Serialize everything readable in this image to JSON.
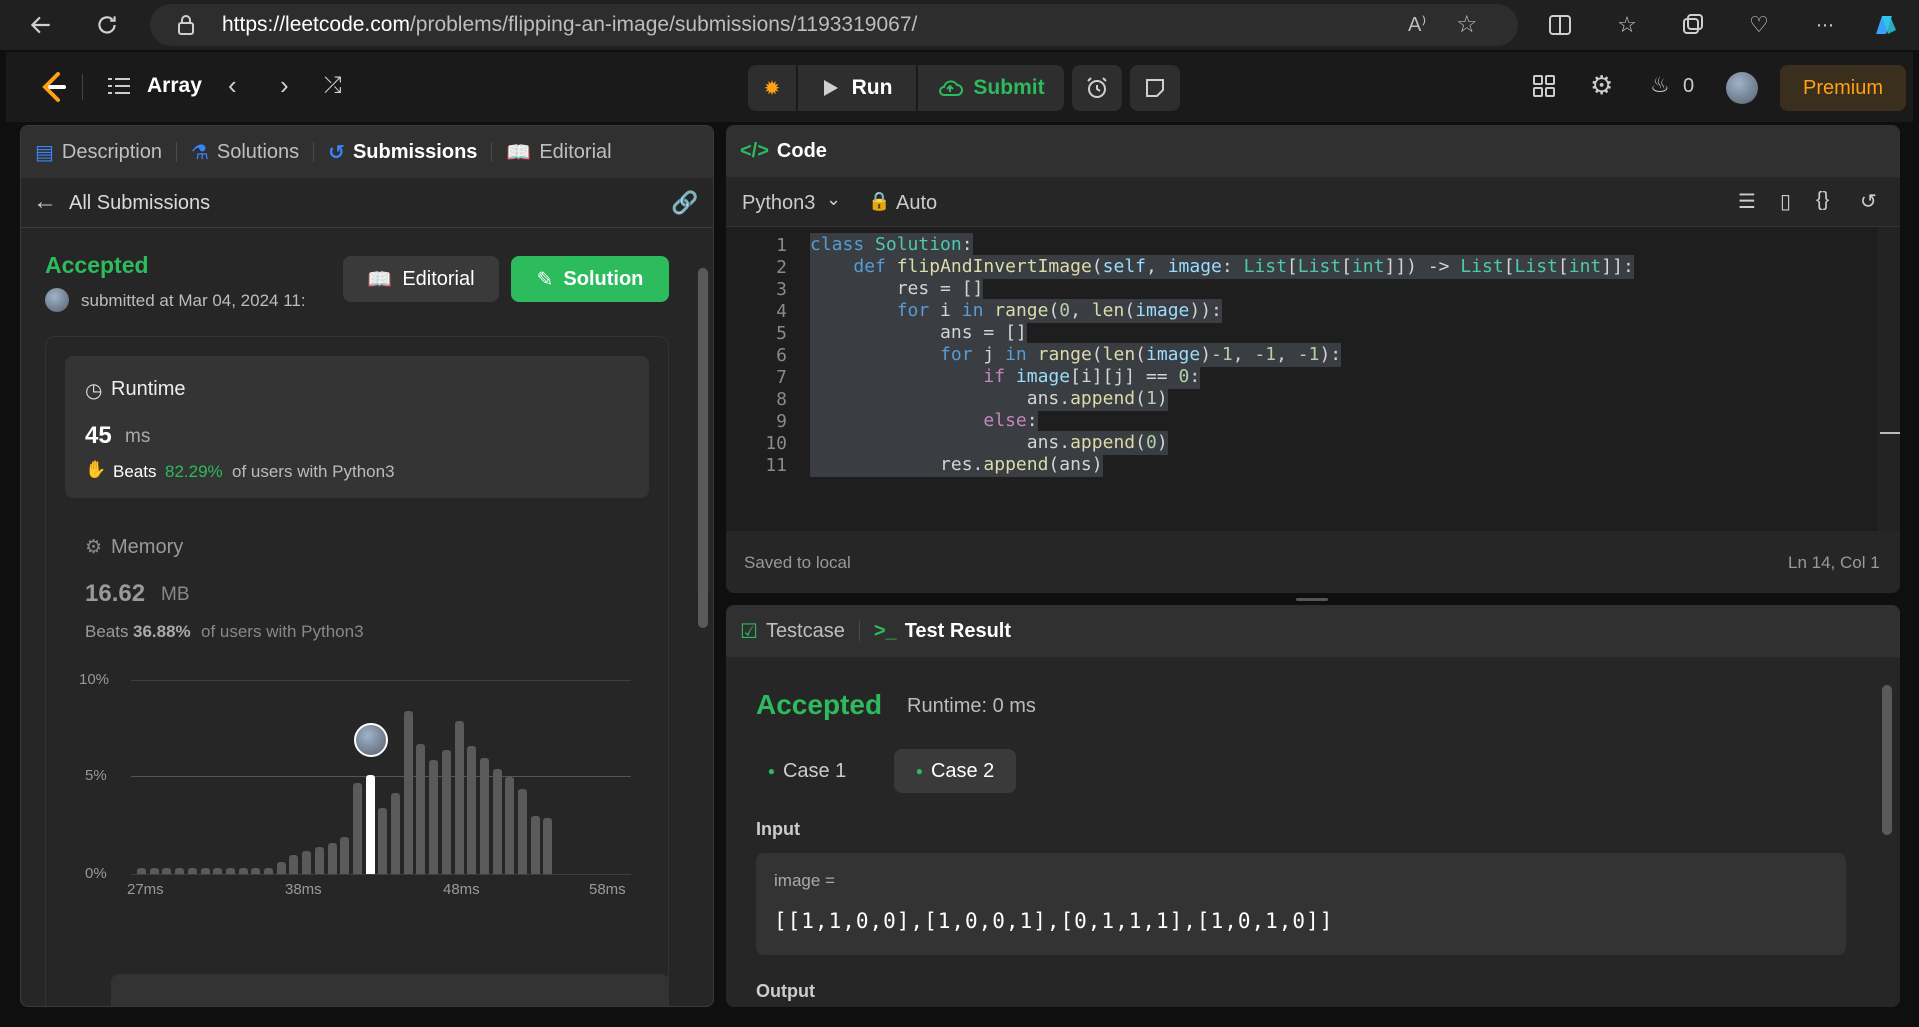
{
  "browser": {
    "url_host": "https://leetcode.com",
    "url_path": "/problems/flipping-an-image/submissions/1193319067/"
  },
  "appbar": {
    "problem_list": "Array",
    "run": "Run",
    "submit": "Submit",
    "streak": "0",
    "premium": "Premium"
  },
  "left": {
    "tabs": [
      "Description",
      "Solutions",
      "Submissions",
      "Editorial"
    ],
    "all_submissions": "All Submissions",
    "status": "Accepted",
    "submitted": "submitted at Mar 04, 2024 11:",
    "editorial_btn": "Editorial",
    "solution_btn": "Solution",
    "runtime": {
      "title": "Runtime",
      "value": "45",
      "unit": "ms",
      "beats_label": "Beats",
      "beats_pct": "82.29%",
      "beats_tail": "of users with Python3"
    },
    "memory": {
      "title": "Memory",
      "value": "16.62",
      "unit": "MB",
      "beats_label": "Beats",
      "beats_pct": "36.88%",
      "beats_tail": "of users with Python3"
    }
  },
  "chart_data": {
    "type": "bar",
    "y_ticks": [
      "10%",
      "5%",
      "0%"
    ],
    "x_ticks": [
      "27ms",
      "38ms",
      "48ms",
      "58ms"
    ],
    "ylim": [
      0,
      10
    ],
    "values": [
      0.3,
      0.3,
      0.3,
      0.3,
      0.3,
      0.3,
      0.3,
      0.3,
      0.3,
      0.3,
      0.3,
      0.6,
      1.0,
      1.2,
      1.4,
      1.6,
      1.9,
      4.7,
      5.1,
      3.4,
      4.2,
      8.4,
      6.7,
      5.9,
      6.4,
      7.9,
      6.6,
      6.0,
      5.4,
      5.0,
      4.4,
      3.0,
      2.9
    ],
    "highlight_index": 18
  },
  "code": {
    "language": "Python3",
    "mode": "Auto",
    "title": "Code",
    "saved": "Saved to local",
    "position": "Ln 14, Col 1",
    "lines": [
      "class Solution:",
      "    def flipAndInvertImage(self, image: List[List[int]]) -> List[List[int]]:",
      "        res = []",
      "        for i in range(0, len(image)):",
      "            ans = []",
      "            for j in range(len(image)-1, -1, -1):",
      "                if image[i][j] == 0:",
      "                    ans.append(1)",
      "                else:",
      "                    ans.append(0)",
      "            res.append(ans)"
    ],
    "line_numbers": [
      "1",
      "2",
      "3",
      "4",
      "5",
      "6",
      "7",
      "8",
      "9",
      "10",
      "11"
    ]
  },
  "test": {
    "tab1": "Testcase",
    "tab2": "Test Result",
    "status": "Accepted",
    "runtime": "Runtime: 0 ms",
    "case1": "Case 1",
    "case2": "Case 2",
    "input_label": "Input",
    "var": "image =",
    "value": "[[1,1,0,0],[1,0,0,1],[0,1,1,1],[1,0,1,0]]",
    "output_label": "Output"
  },
  "colors": {
    "accent_green": "#2cbb5d",
    "premium": "#ffa116",
    "blue": "#3b82f6"
  }
}
